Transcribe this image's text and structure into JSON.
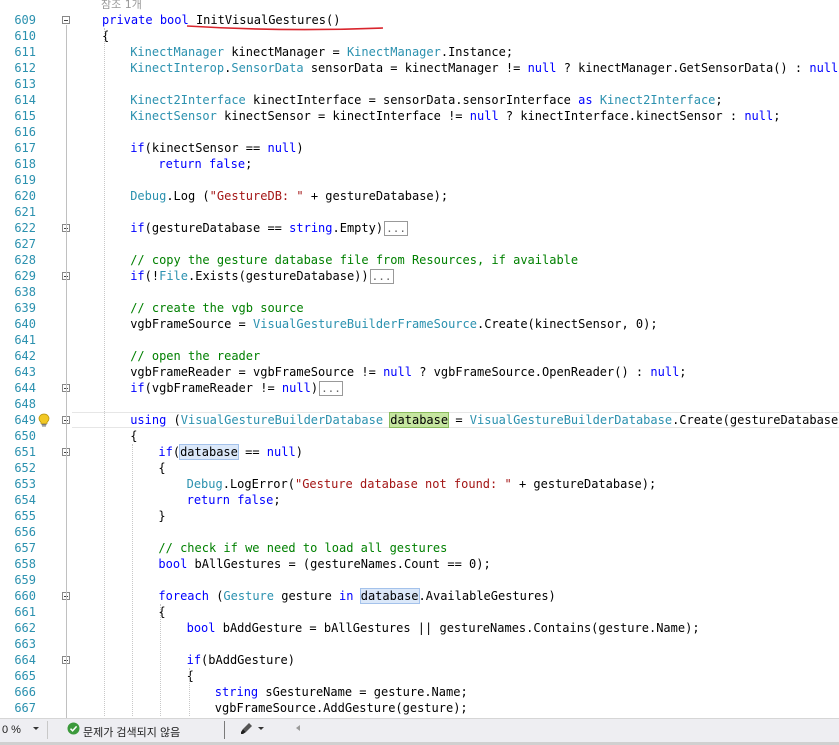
{
  "editor": {
    "codelens_ref": "참조 1개",
    "lines": [
      {
        "n": "609",
        "fold": "minus",
        "indent": 0,
        "html": "<span class='kw'>private</span> <span class='kw'>bool</span> InitVisualGestures()"
      },
      {
        "n": "610",
        "indent": 0,
        "html": "{"
      },
      {
        "n": "611",
        "indent": 1,
        "html": "<span class='ty'>KinectManager</span> kinectManager = <span class='ty'>KinectManager</span>.Instance;"
      },
      {
        "n": "612",
        "indent": 1,
        "html": "<span class='ty'>KinectInterop</span>.<span class='ty'>SensorData</span> sensorData = kinectManager != <span class='kw'>null</span> ? kinectManager.GetSensorData() : <span class='kw'>null</span>;"
      },
      {
        "n": "613",
        "indent": 1,
        "html": ""
      },
      {
        "n": "614",
        "indent": 1,
        "html": "<span class='ty'>Kinect2Interface</span> kinectInterface = sensorData.sensorInterface <span class='kw'>as</span> <span class='ty'>Kinect2Interface</span>;"
      },
      {
        "n": "615",
        "indent": 1,
        "html": "<span class='ty'>KinectSensor</span> kinectSensor = kinectInterface != <span class='kw'>null</span> ? kinectInterface.kinectSensor : <span class='kw'>null</span>;"
      },
      {
        "n": "616",
        "indent": 1,
        "html": ""
      },
      {
        "n": "617",
        "indent": 1,
        "html": "<span class='kw'>if</span>(kinectSensor == <span class='kw'>null</span>)"
      },
      {
        "n": "618",
        "indent": 2,
        "html": "<span class='kw'>return</span> <span class='kw'>false</span>;"
      },
      {
        "n": "619",
        "indent": 1,
        "html": ""
      },
      {
        "n": "620",
        "indent": 1,
        "html": "<span class='ty'>Debug</span>.Log (<span class='st'>\"GestureDB: \"</span> + gestureDatabase);"
      },
      {
        "n": "621",
        "indent": 1,
        "html": ""
      },
      {
        "n": "622",
        "fold": "plus",
        "indent": 1,
        "html": "<span class='kw'>if</span>(gestureDatabase == <span class='kw'>string</span>.Empty)<span class='collapsed'>...</span>"
      },
      {
        "n": "627",
        "indent": 1,
        "html": ""
      },
      {
        "n": "628",
        "indent": 1,
        "html": "<span class='cm'>// copy the gesture database file from Resources, if available</span>"
      },
      {
        "n": "629",
        "fold": "plus",
        "indent": 1,
        "html": "<span class='kw'>if</span>(!<span class='ty'>File</span>.Exists(gestureDatabase))<span class='collapsed'>...</span>"
      },
      {
        "n": "638",
        "indent": 1,
        "html": ""
      },
      {
        "n": "639",
        "indent": 1,
        "html": "<span class='cm'>// create the vgb source</span>"
      },
      {
        "n": "640",
        "indent": 1,
        "html": "vgbFrameSource = <span class='ty'>VisualGestureBuilderFrameSource</span>.Create(kinectSensor, 0);"
      },
      {
        "n": "641",
        "indent": 1,
        "html": ""
      },
      {
        "n": "642",
        "indent": 1,
        "html": "<span class='cm'>// open the reader</span>"
      },
      {
        "n": "643",
        "indent": 1,
        "html": "vgbFrameReader = vgbFrameSource != <span class='kw'>null</span> ? vgbFrameSource.OpenReader() : <span class='kw'>null</span>;"
      },
      {
        "n": "644",
        "fold": "plus",
        "indent": 1,
        "html": "<span class='kw'>if</span>(vgbFrameReader != <span class='kw'>null</span>)<span class='collapsed'>...</span>"
      },
      {
        "n": "648",
        "indent": 1,
        "html": ""
      },
      {
        "n": "649",
        "fold": "minus",
        "indent": 1,
        "html": "<span class='kw'>using</span> (<span class='ty'>VisualGestureBuilderDatabase</span> <span class='def-hl'>database</span> = <span class='ty'>VisualGestureBuilderDatabase</span>.Create(gestureDatabase))"
      },
      {
        "n": "650",
        "indent": 1,
        "html": "{"
      },
      {
        "n": "651",
        "fold": "minus",
        "indent": 2,
        "html": "<span class='kw'>if</span>(<span class='ref-hl'>database</span> == <span class='kw'>null</span>)"
      },
      {
        "n": "652",
        "indent": 2,
        "html": "{"
      },
      {
        "n": "653",
        "indent": 3,
        "html": "<span class='ty'>Debug</span>.LogError(<span class='st'>\"Gesture database not found: \"</span> + gestureDatabase);"
      },
      {
        "n": "654",
        "indent": 3,
        "html": "<span class='kw'>return</span> <span class='kw'>false</span>;"
      },
      {
        "n": "655",
        "indent": 2,
        "html": "}"
      },
      {
        "n": "656",
        "indent": 2,
        "html": ""
      },
      {
        "n": "657",
        "indent": 2,
        "html": "<span class='cm'>// check if we need to load all gestures</span>"
      },
      {
        "n": "658",
        "indent": 2,
        "html": "<span class='kw'>bool</span> bAllGestures = (gestureNames.Count == 0);"
      },
      {
        "n": "659",
        "indent": 2,
        "html": ""
      },
      {
        "n": "660",
        "fold": "minus",
        "indent": 2,
        "html": "<span class='kw'>foreach</span> (<span class='ty'>Gesture</span> gesture <span class='kw'>in</span> <span class='ref-hl'>database</span>.AvailableGestures)"
      },
      {
        "n": "661",
        "indent": 2,
        "html": "{"
      },
      {
        "n": "662",
        "indent": 3,
        "html": "<span class='kw'>bool</span> bAddGesture = bAllGestures || gestureNames.Contains(gesture.Name);"
      },
      {
        "n": "663",
        "indent": 3,
        "html": ""
      },
      {
        "n": "664",
        "fold": "minus",
        "indent": 3,
        "html": "<span class='kw'>if</span>(bAddGesture)"
      },
      {
        "n": "665",
        "indent": 3,
        "html": "{"
      },
      {
        "n": "666",
        "indent": 4,
        "html": "<span class='kw'>string</span> sGestureName = gesture.Name;"
      },
      {
        "n": "667",
        "indent": 4,
        "html": "vgbFrameSource.AddGesture(gesture);"
      }
    ]
  },
  "statusbar": {
    "zoom": "0 %",
    "zoom_dropdown_icon": "caret-down",
    "issues_text": "문제가 검색되지 않음",
    "issues_icon": "check-circle",
    "brush_icon": "brush"
  }
}
